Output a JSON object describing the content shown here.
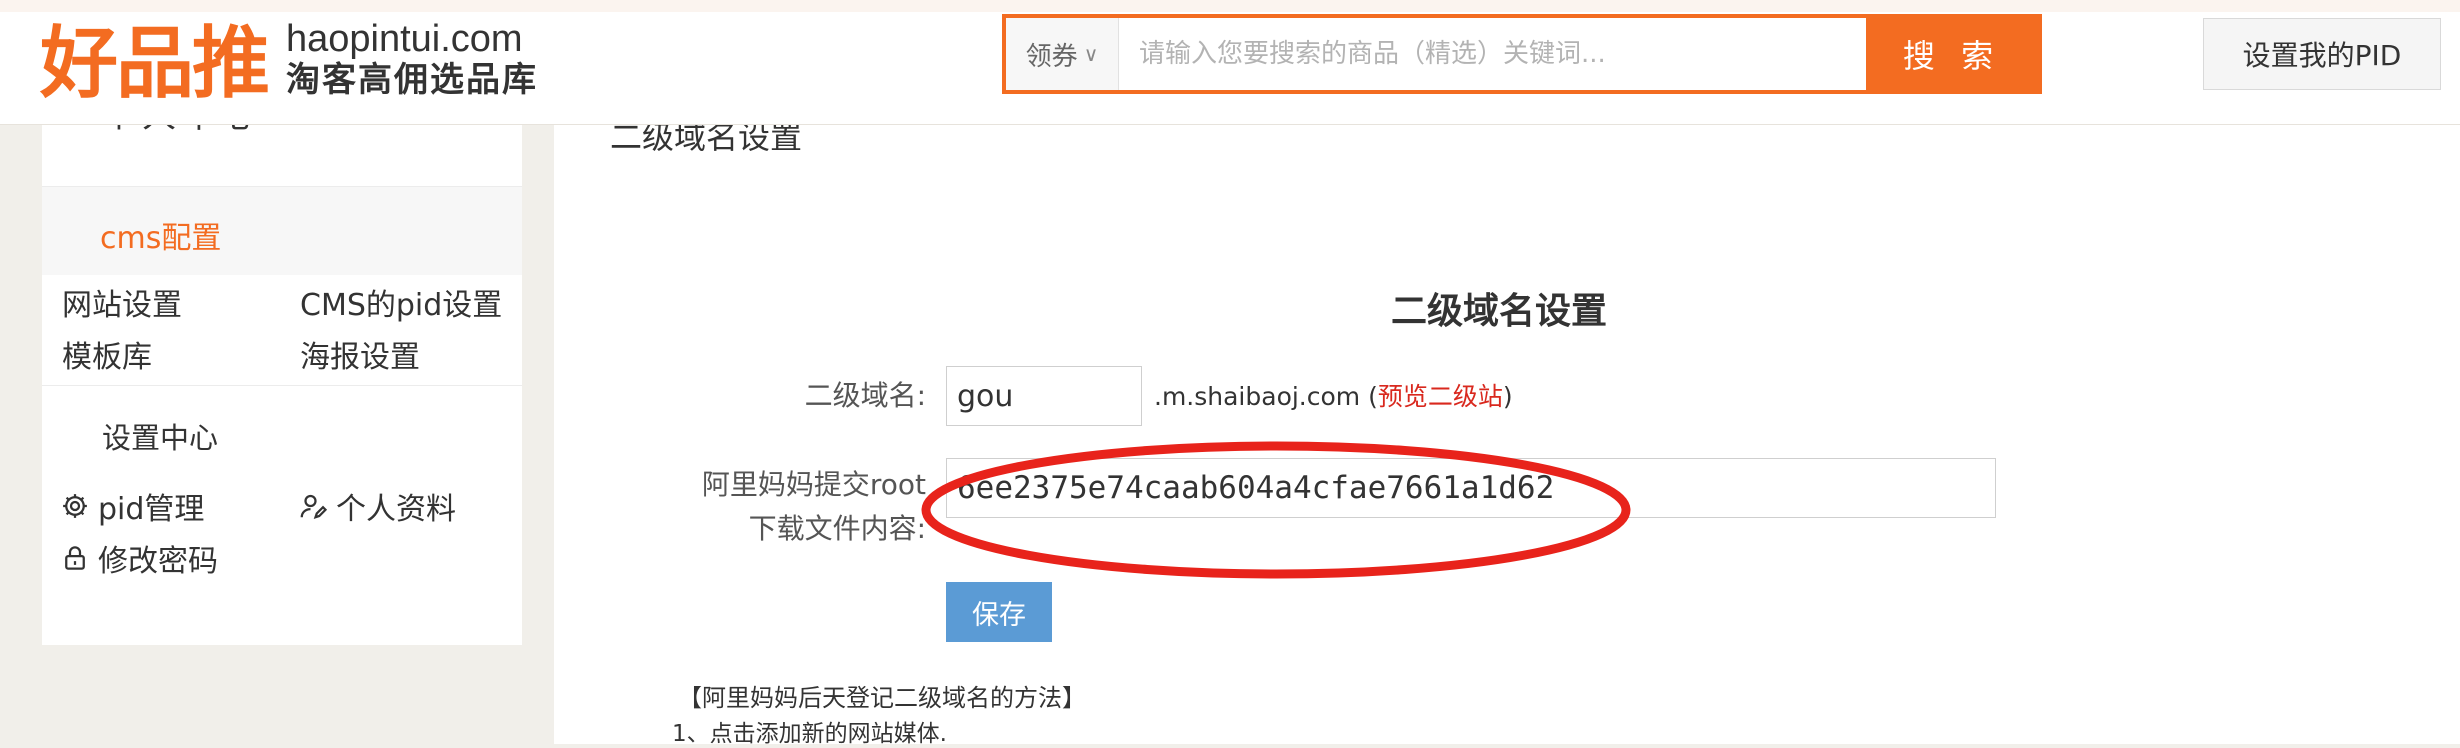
{
  "header": {
    "logo_cn": "好品推",
    "logo_en": "haopintui.com",
    "logo_sub": "淘客高佣选品库",
    "search": {
      "scope": "领券",
      "placeholder": "请输入您要搜索的商品（精选）关键词...",
      "button_label": "搜 索"
    },
    "pid_button": "设置我的PID"
  },
  "sidebar": {
    "title": "个人中心",
    "cms_section": "cms配置",
    "cms_items": [
      {
        "label": "网站设置"
      },
      {
        "label": "CMS的pid设置"
      },
      {
        "label": "模板库"
      },
      {
        "label": "海报设置"
      }
    ],
    "settings_section": "设置中心",
    "settings_items": [
      {
        "label": "pid管理",
        "icon": "gear-icon"
      },
      {
        "label": "个人资料",
        "icon": "user-edit-icon"
      },
      {
        "label": "修改密码",
        "icon": "lock-icon"
      }
    ]
  },
  "main": {
    "breadcrumb": "二级域名设置",
    "form_title": "二级域名设置",
    "domain_label": "二级域名:",
    "domain_value": "gou",
    "domain_suffix": ".m.shaibaoj.com (",
    "preview_link": "预览二级站",
    "domain_suffix_end": ")",
    "root_label_line1": "阿里妈妈提交root",
    "root_label_line2": "下载文件内容:",
    "root_value": "6ee2375e74caab604a4cfae7661a1d62",
    "save_button": "保存",
    "method_title": "【阿里妈妈后天登记二级域名的方法】",
    "method_step_1": "1、点击添加新的网站媒体."
  },
  "colors": {
    "brand_orange": "#f36c21",
    "save_blue": "#5b9bd5",
    "link_red": "#d9281e",
    "annotation_red": "#e8231b"
  }
}
